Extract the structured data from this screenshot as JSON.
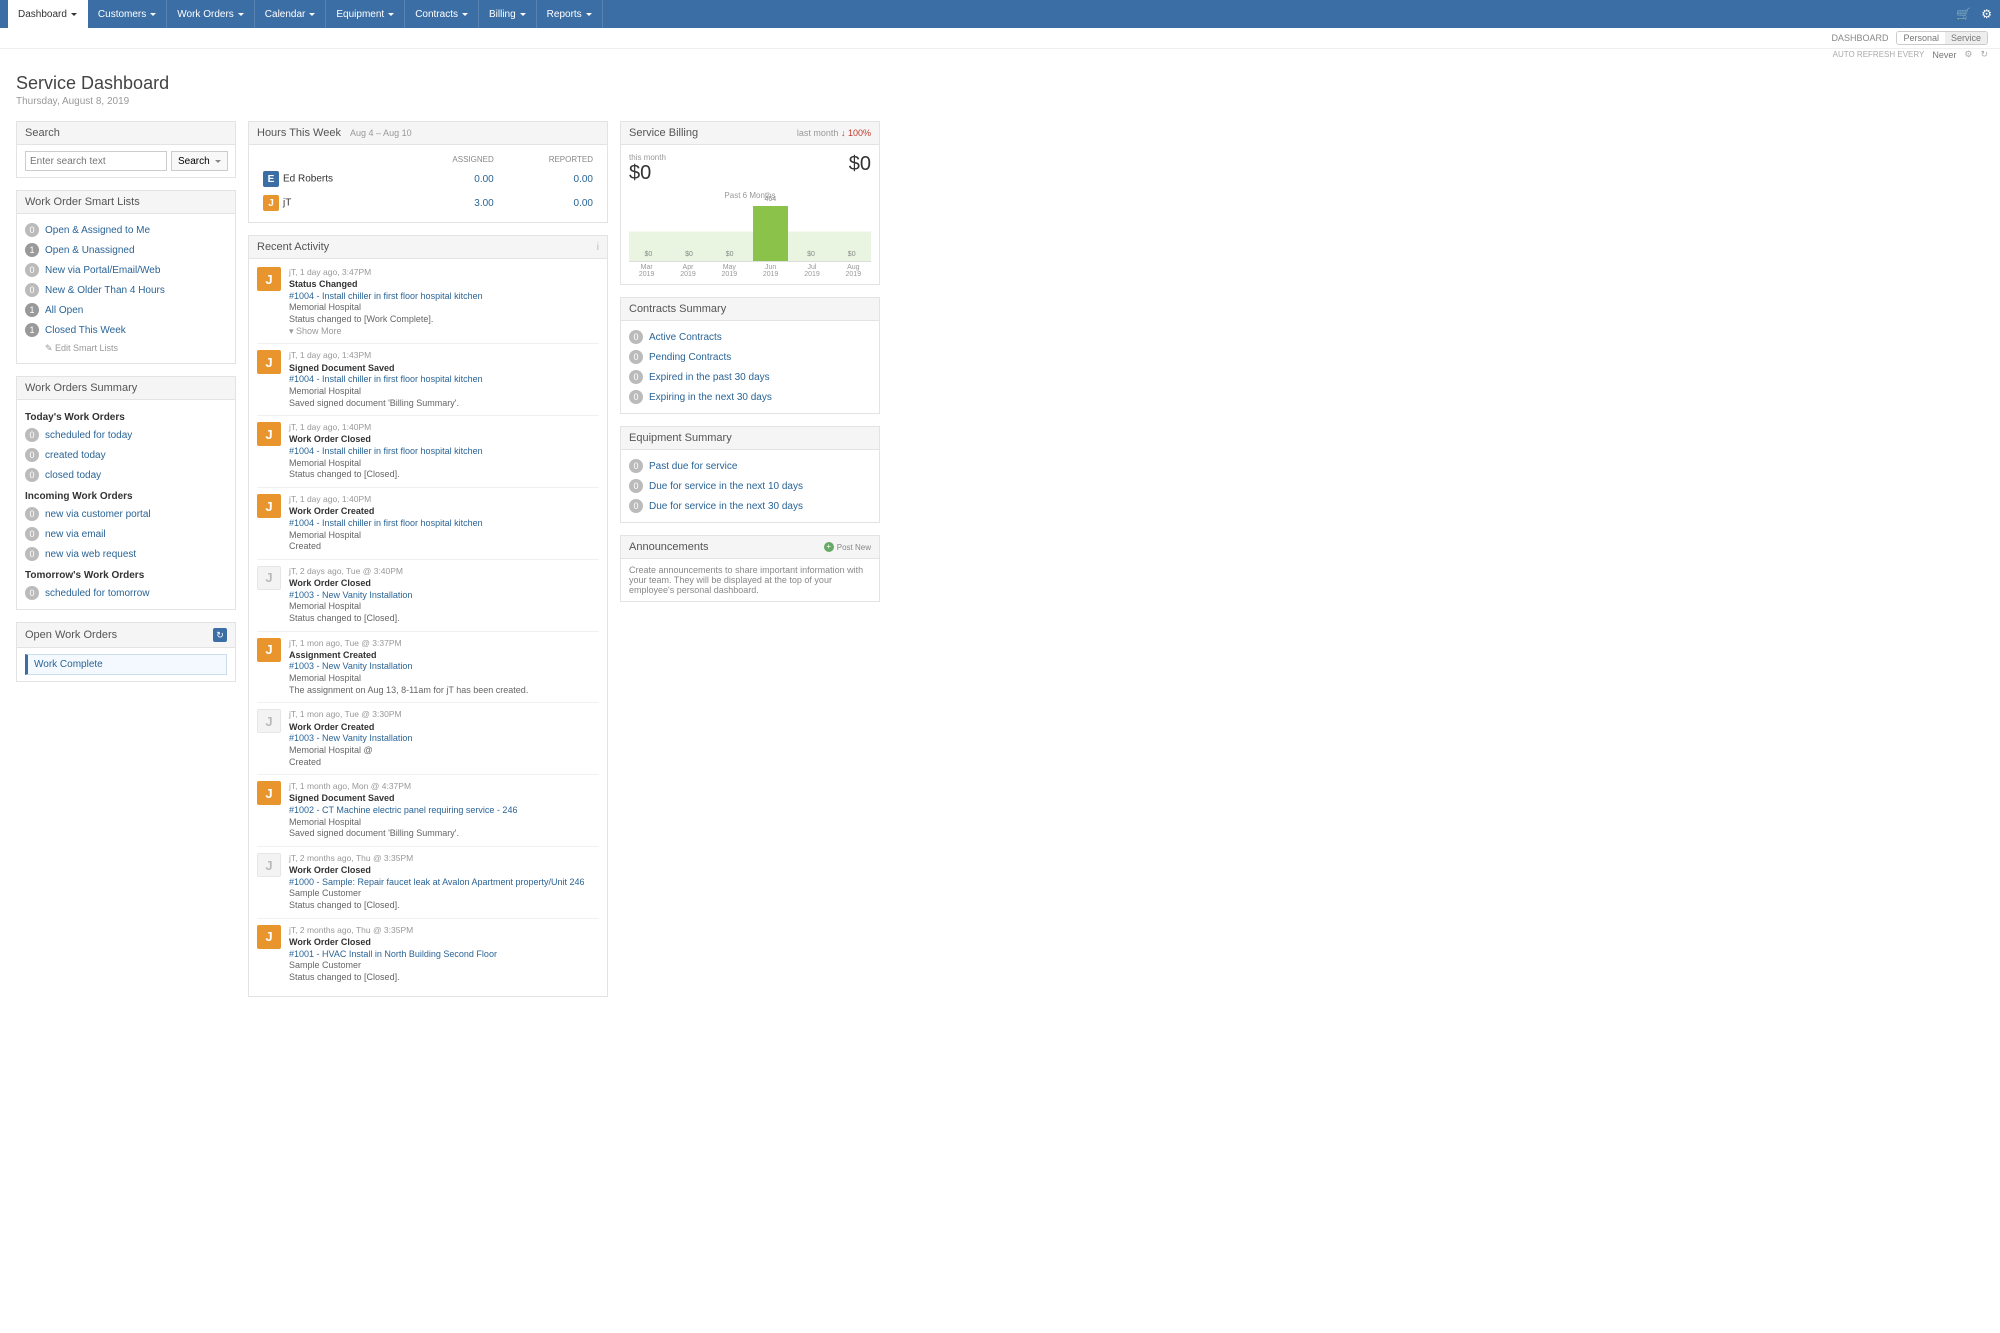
{
  "nav": {
    "tabs": [
      "Dashboard",
      "Customers",
      "Work Orders",
      "Calendar",
      "Equipment",
      "Contracts",
      "Billing",
      "Reports"
    ],
    "active": 0
  },
  "subbar": {
    "dashboard_label": "DASHBOARD",
    "toggle": [
      "Personal",
      "Service"
    ],
    "toggle_active": 1,
    "refresh_label": "AUTO REFRESH EVERY",
    "refresh_value": "Never"
  },
  "header": {
    "title": "Service Dashboard",
    "date": "Thursday, August 8, 2019"
  },
  "search": {
    "panel_title": "Search",
    "placeholder": "Enter search text",
    "button": "Search"
  },
  "smart_lists": {
    "panel_title": "Work Order Smart Lists",
    "items": [
      {
        "count": 0,
        "label": "Open & Assigned to Me"
      },
      {
        "count": 1,
        "label": "Open & Unassigned"
      },
      {
        "count": 0,
        "label": "New via Portal/Email/Web"
      },
      {
        "count": 0,
        "label": "New & Older Than 4 Hours"
      },
      {
        "count": 1,
        "label": "All Open"
      },
      {
        "count": 1,
        "label": "Closed This Week"
      }
    ],
    "edit_link": "Edit Smart Lists"
  },
  "wo_summary": {
    "panel_title": "Work Orders Summary",
    "groups": [
      {
        "title": "Today's Work Orders",
        "rows": [
          {
            "count": 0,
            "label": "scheduled for today"
          },
          {
            "count": 0,
            "label": "created today"
          },
          {
            "count": 0,
            "label": "closed today"
          }
        ]
      },
      {
        "title": "Incoming Work Orders",
        "rows": [
          {
            "count": 0,
            "label": "new via customer portal"
          },
          {
            "count": 0,
            "label": "new via email"
          },
          {
            "count": 0,
            "label": "new via web request"
          }
        ]
      },
      {
        "title": "Tomorrow's Work Orders",
        "rows": [
          {
            "count": 0,
            "label": "scheduled for tomorrow"
          }
        ]
      }
    ]
  },
  "open_wo": {
    "panel_title": "Open Work Orders",
    "item": "Work Complete"
  },
  "hours": {
    "panel_title": "Hours This Week",
    "range": "Aug 4 – Aug 10",
    "col_assigned": "ASSIGNED",
    "col_reported": "REPORTED",
    "rows": [
      {
        "avatar": "E",
        "avatar_color": "blue",
        "name": "Ed Roberts",
        "assigned": "0.00",
        "reported": "0.00"
      },
      {
        "avatar": "J",
        "avatar_color": "orange",
        "name": "jT",
        "assigned": "3.00",
        "reported": "0.00"
      }
    ]
  },
  "activity": {
    "panel_title": "Recent Activity",
    "show_more": "Show More",
    "items": [
      {
        "muted": false,
        "meta": "jT, 1 day ago, 3:47PM",
        "title": "Status Changed",
        "link": "#1004 - Install chiller in first floor hospital kitchen",
        "sub1": "Memorial Hospital",
        "sub2": "Status changed to [Work Complete].",
        "show_more": true
      },
      {
        "muted": false,
        "meta": "jT, 1 day ago, 1:43PM",
        "title": "Signed Document Saved",
        "link": "#1004 - Install chiller in first floor hospital kitchen",
        "sub1": "Memorial Hospital",
        "sub2": "Saved signed document 'Billing Summary'."
      },
      {
        "muted": false,
        "meta": "jT, 1 day ago, 1:40PM",
        "title": "Work Order Closed",
        "link": "#1004 - Install chiller in first floor hospital kitchen",
        "sub1": "Memorial Hospital",
        "sub2": "Status changed to [Closed]."
      },
      {
        "muted": false,
        "meta": "jT, 1 day ago, 1:40PM",
        "title": "Work Order Created",
        "link": "#1004 - Install chiller in first floor hospital kitchen",
        "sub1": "Memorial Hospital",
        "sub2": "Created"
      },
      {
        "muted": true,
        "meta": "jT, 2 days ago, Tue @ 3:40PM",
        "title": "Work Order Closed",
        "link": "#1003 - New Vanity Installation",
        "sub1": "Memorial Hospital",
        "sub2": "Status changed to [Closed]."
      },
      {
        "muted": false,
        "meta": "jT, 1 mon ago, Tue @ 3:37PM",
        "title": "Assignment Created",
        "link": "#1003 - New Vanity Installation",
        "sub1": "Memorial Hospital",
        "sub2": "The assignment on Aug 13, 8-11am for jT has been created."
      },
      {
        "muted": true,
        "meta": "jT, 1 mon ago, Tue @ 3:30PM",
        "title": "Work Order Created",
        "link": "#1003 - New Vanity Installation",
        "sub1": "Memorial Hospital @",
        "sub2": "Created"
      },
      {
        "muted": false,
        "meta": "jT, 1 month ago, Mon @ 4:37PM",
        "title": "Signed Document Saved",
        "link": "#1002 - CT Machine electric panel requiring service - 246",
        "sub1": "Memorial Hospital",
        "sub2": "Saved signed document 'Billing Summary'."
      },
      {
        "muted": true,
        "meta": "jT, 2 months ago, Thu @ 3:35PM",
        "title": "Work Order Closed",
        "link": "#1000 - Sample: Repair faucet leak at Avalon Apartment property/Unit 246",
        "sub1": "Sample Customer",
        "sub2": "Status changed to [Closed]."
      },
      {
        "muted": false,
        "meta": "jT, 2 months ago, Thu @ 3:35PM",
        "title": "Work Order Closed",
        "link": "#1001 - HVAC Install in North Building Second Floor",
        "sub1": "Sample Customer",
        "sub2": "Status changed to [Closed]."
      }
    ]
  },
  "billing": {
    "panel_title": "Service Billing",
    "last_month_label": "last month",
    "delta": "↓ 100%",
    "this_month_label": "this month",
    "this_month_value": "$0",
    "last_month_value": "$0",
    "spark_title": "Past 6 Months"
  },
  "contracts": {
    "panel_title": "Contracts Summary",
    "rows": [
      {
        "count": 0,
        "label": "Active Contracts"
      },
      {
        "count": 0,
        "label": "Pending Contracts"
      },
      {
        "count": 0,
        "label": "Expired in the past 30 days"
      },
      {
        "count": 0,
        "label": "Expiring in the next 30 days"
      }
    ]
  },
  "equipment": {
    "panel_title": "Equipment Summary",
    "rows": [
      {
        "count": 0,
        "label": "Past due for service"
      },
      {
        "count": 0,
        "label": "Due for service in the next 10 days"
      },
      {
        "count": 0,
        "label": "Due for service in the next 30 days"
      }
    ]
  },
  "announcements": {
    "panel_title": "Announcements",
    "right_label": "Post New",
    "body": "Create announcements to share important information with your team. They will be displayed at the top of your employee's personal dashboard."
  },
  "chart_data": {
    "type": "bar",
    "title": "Past 6 Months",
    "categories": [
      "Mar 2019",
      "Apr 2019",
      "May 2019",
      "Jun 2019",
      "Jul 2019",
      "Aug 2019"
    ],
    "values": [
      0,
      0,
      0,
      464,
      0,
      0
    ],
    "ylim": [
      0,
      500
    ],
    "ylabel": "",
    "xlabel": ""
  }
}
